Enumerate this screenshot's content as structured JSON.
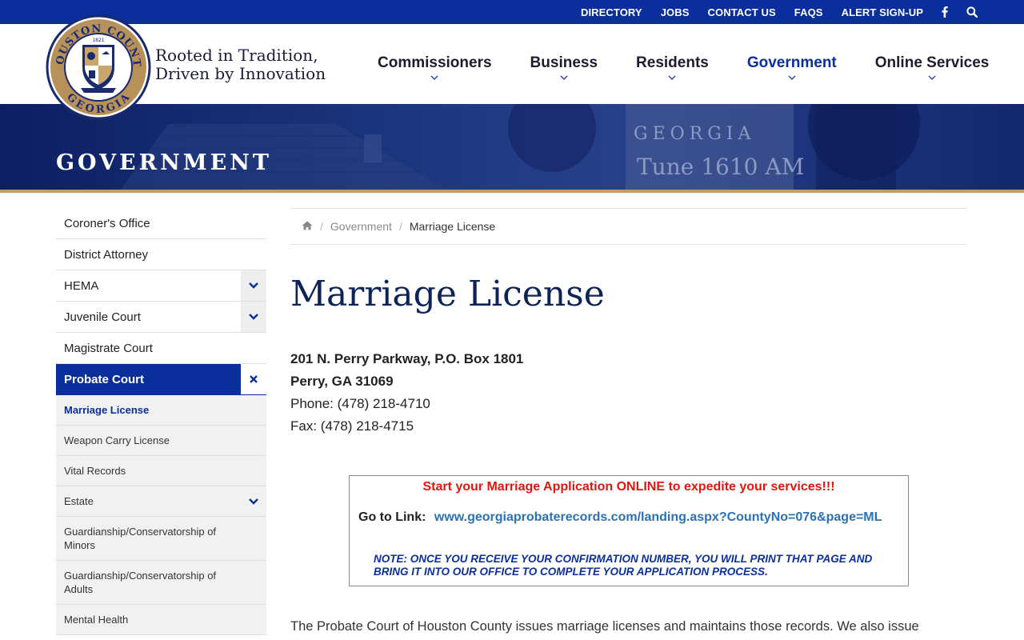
{
  "topbar": {
    "links": [
      "DIRECTORY",
      "JOBS",
      "CONTACT US",
      "FAQS",
      "ALERT SIGN-UP"
    ],
    "facebook_icon": "facebook-icon",
    "search_icon": "search-icon"
  },
  "header": {
    "seal_top_text": "HOUSTON COUNTY",
    "seal_bottom_text": "GEORGIA",
    "seal_year": "1821",
    "tagline_line1": "Rooted in Tradition,",
    "tagline_line2": "Driven by Innovation"
  },
  "nav": {
    "items": [
      {
        "label": "Commissioners"
      },
      {
        "label": "Business"
      },
      {
        "label": "Residents"
      },
      {
        "label": "Government"
      },
      {
        "label": "Online Services"
      }
    ],
    "active": "Government"
  },
  "banner": {
    "title": "GOVERNMENT",
    "sign_line1": "GEORGIA",
    "sign_line2": "Tune 1610 AM"
  },
  "sidebar": {
    "items": [
      {
        "label": "Coroner's Office"
      },
      {
        "label": "District Attorney"
      },
      {
        "label": "HEMA"
      },
      {
        "label": "Juvenile Court"
      },
      {
        "label": "Magistrate Court"
      },
      {
        "label": "Probate Court"
      }
    ],
    "subitems": [
      {
        "label": "Marriage License"
      },
      {
        "label": "Weapon Carry License"
      },
      {
        "label": "Vital Records"
      },
      {
        "label": "Estate"
      },
      {
        "label": "Guardianship/Conservatorship of Minors"
      },
      {
        "label": "Guardianship/Conservatorship of Adults"
      },
      {
        "label": "Mental Health"
      }
    ]
  },
  "breadcrumb": {
    "home_icon": "home-icon",
    "parent": "Government",
    "current": "Marriage License"
  },
  "page": {
    "title": "Marriage License",
    "address_line1": "201 N. Perry Parkway, P.O. Box 1801",
    "address_line2": "Perry, GA 31069",
    "phone": "Phone: (478) 218-4710",
    "fax": "Fax: (478) 218-4715"
  },
  "notice": {
    "headline": "Start your Marriage Application ONLINE to expedite your services!!!",
    "link_label": "Go to Link:",
    "link_text": "www.georgiaprobaterecords.com/landing.aspx?CountyNo=076&page=ML",
    "note": "NOTE: ONCE YOU RECEIVE YOUR CONFIRMATION NUMBER, YOU WILL PRINT THAT PAGE AND BRING IT INTO OUR OFFICE TO COMPLETE YOUR APPLICATION PROCESS."
  },
  "intro": {
    "text": "The Probate Court of Houston County issues marriage licenses and maintains those records. We also issue"
  },
  "colors": {
    "brand_blue": "#0a2f9c",
    "navy": "#0e2456",
    "accent_tan": "#c79a6a",
    "alert_red": "#e0170f",
    "link_blue": "#2a72b5"
  }
}
